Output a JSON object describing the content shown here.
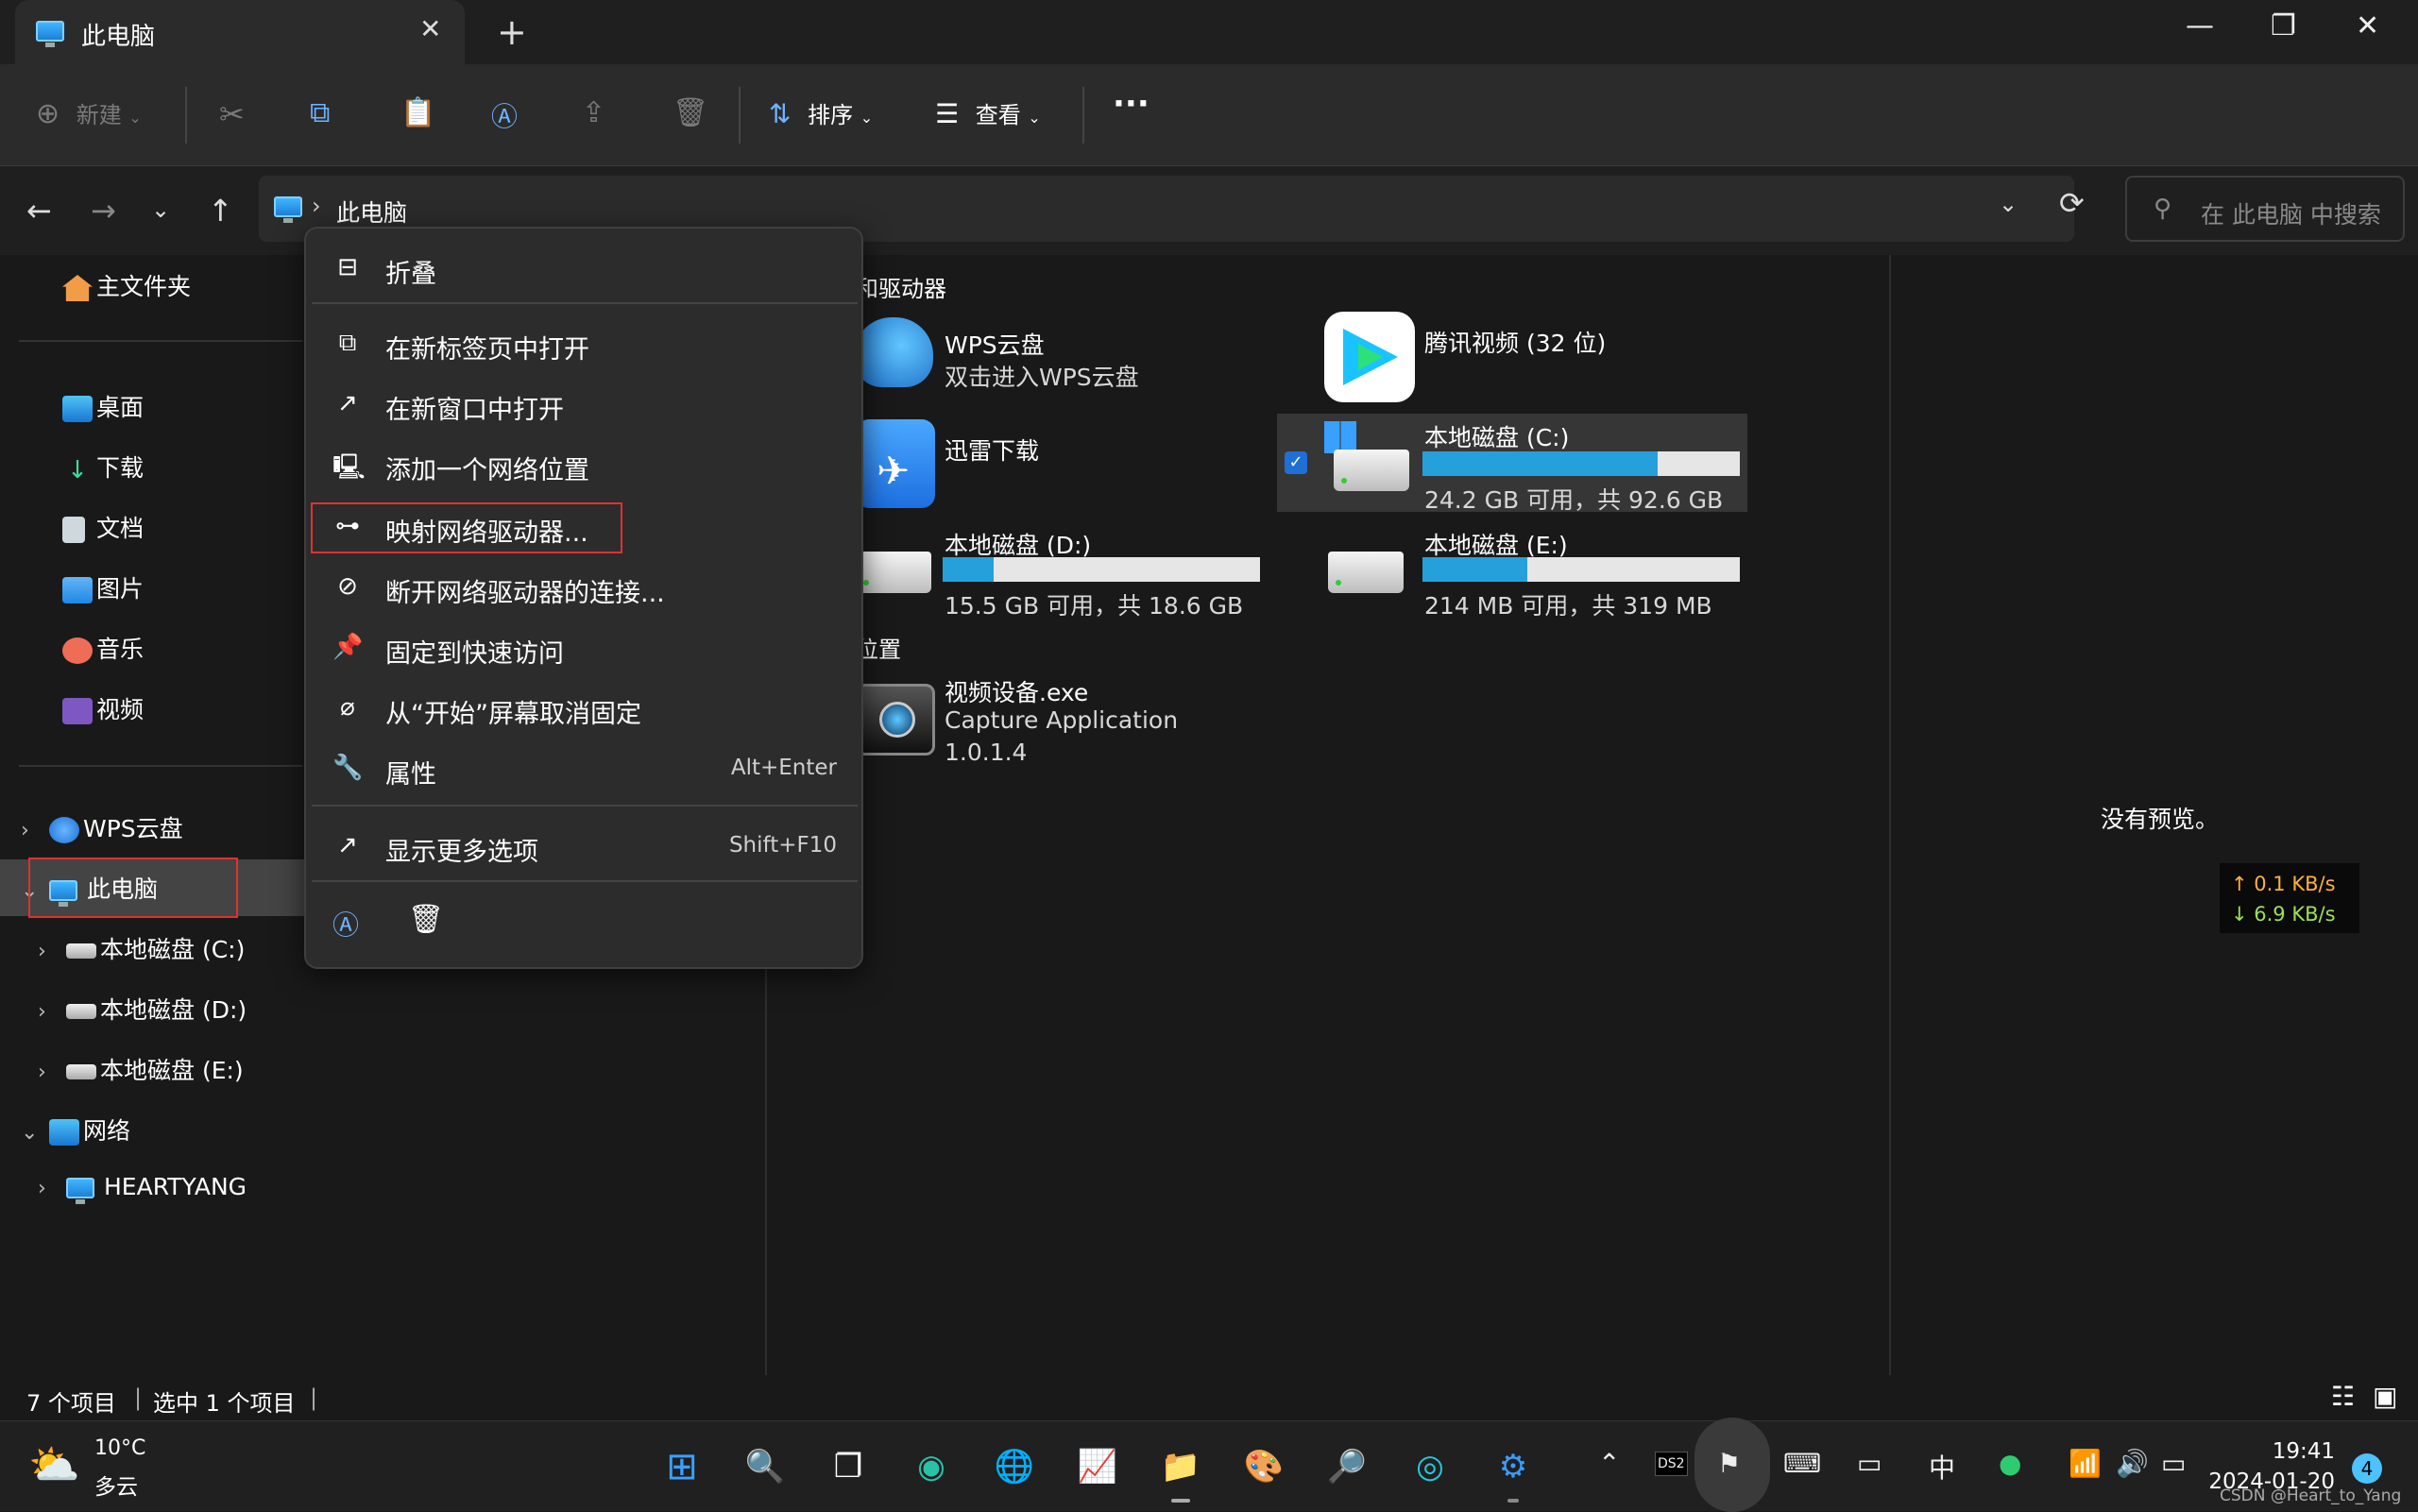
{
  "window": {
    "tab_title": "此电脑",
    "tab_close": "✕",
    "new_tab": "+",
    "minimize": "—",
    "restore": "❐",
    "close": "✕"
  },
  "toolbar": {
    "new_label": "新建",
    "sort_label": "排序",
    "view_label": "查看",
    "more_label": "···"
  },
  "address": {
    "breadcrumb": "此电脑",
    "search_placeholder": "在 此电脑 中搜索"
  },
  "sidebar": {
    "home": "主文件夹",
    "quick": [
      "桌面",
      "下载",
      "文档",
      "图片",
      "音乐",
      "视频"
    ],
    "wps": "WPS云盘",
    "thispc": "此电脑",
    "drives": [
      "本地磁盘 (C:)",
      "本地磁盘 (D:)",
      "本地磁盘 (E:)"
    ],
    "network": "网络",
    "network_child": "HEARTYANG"
  },
  "content": {
    "group_drives": "和驱动器",
    "group_locations": "位置",
    "wps_title": "WPS云盘",
    "wps_sub": "双击进入WPS云盘",
    "tencent_title": "腾讯视频 (32 位)",
    "xunlei_title": "迅雷下载",
    "c_title": "本地磁盘 (C:)",
    "c_sub": "24.2 GB 可用，共 92.6 GB",
    "c_used": 0.74,
    "d_title": "本地磁盘 (D:)",
    "d_sub": "15.5 GB 可用，共 18.6 GB",
    "d_used": 0.16,
    "e_title": "本地磁盘 (E:)",
    "e_sub": "214 MB 可用，共 319 MB",
    "e_used": 0.33,
    "video_title": "视频设备.exe",
    "video_sub1": "Capture Application",
    "video_sub2": "1.0.1.4"
  },
  "preview": {
    "no_preview": "没有预览。",
    "up": "↑ 0.1 KB/s",
    "down": "↓ 6.9 KB/s"
  },
  "status": {
    "items": "7 个项目",
    "selected": "选中 1 个项目"
  },
  "menu": {
    "collapse": "折叠",
    "open_new_tab": "在新标签页中打开",
    "open_new_window": "在新窗口中打开",
    "add_network": "添加一个网络位置",
    "map_drive": "映射网络驱动器...",
    "disconnect": "断开网络驱动器的连接...",
    "pin_quick": "固定到快速访问",
    "unpin_start": "从“开始”屏幕取消固定",
    "properties": "属性",
    "properties_key": "Alt+Enter",
    "more_options": "显示更多选项",
    "more_options_key": "Shift+F10"
  },
  "taskbar": {
    "temp": "10°C",
    "weather": "多云",
    "ime": "中",
    "time": "19:41",
    "date": "2024-01-20",
    "badge": "4",
    "ds2": "DS2"
  },
  "watermark": "CSDN @Heart_to_Yang",
  "colors": {
    "accent": "#26a0da",
    "highlight_box": "#e03131",
    "upload": "#ffb13b",
    "download": "#9be15d"
  }
}
